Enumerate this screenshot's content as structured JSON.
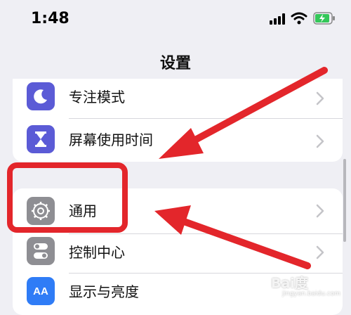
{
  "status_bar": {
    "time": "1:48"
  },
  "nav": {
    "title": "设置"
  },
  "settings_group_1": [
    {
      "label": "专注模式",
      "icon": "moon-icon",
      "icon_color": "#5b5bd6"
    },
    {
      "label": "屏幕使用时间",
      "icon": "hourglass-icon",
      "icon_color": "#5b5bd6"
    }
  ],
  "settings_group_2": [
    {
      "label": "通用",
      "icon": "gear-icon",
      "icon_color": "#8e8e93"
    },
    {
      "label": "控制中心",
      "icon": "toggles-icon",
      "icon_color": "#8e8e93"
    },
    {
      "label": "显示与亮度",
      "icon": "display-aa-icon",
      "icon_color": "#2f7cf6"
    }
  ],
  "annotation": {
    "highlight_color": "#e3262b"
  },
  "watermark": {
    "brand": "Bai度",
    "sub": "jingyan.baidu.com"
  }
}
